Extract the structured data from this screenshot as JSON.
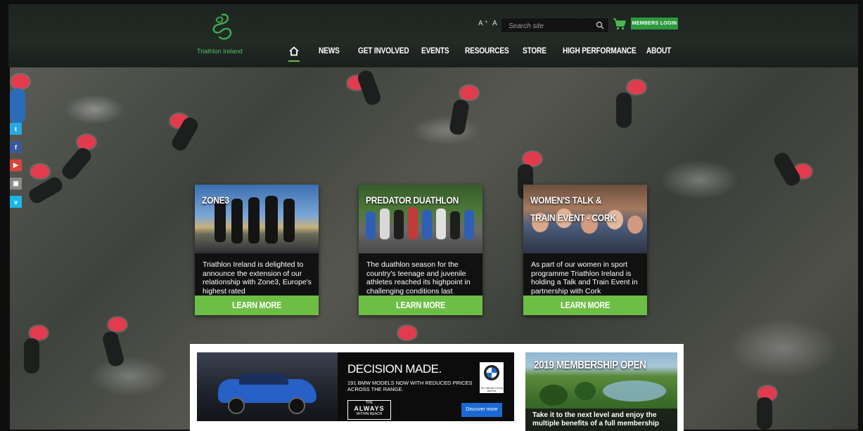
{
  "header": {
    "logo_text": "Triathlon Ireland",
    "font_size_controls": "A⁺ A",
    "search_placeholder": "Search site",
    "members_login": "MEMBERS LOGIN"
  },
  "nav": {
    "items": [
      "NEWS",
      "GET INVOLVED",
      "EVENTS",
      "RESOURCES",
      "STORE",
      "HIGH PERFORMANCE",
      "ABOUT"
    ]
  },
  "social": [
    {
      "icon": "twitter-icon",
      "glyph": "t",
      "color": "#29a9e1"
    },
    {
      "icon": "facebook-icon",
      "glyph": "f",
      "color": "#3b5998"
    },
    {
      "icon": "youtube-icon",
      "glyph": "▶",
      "color": "#d9443b"
    },
    {
      "icon": "instagram-icon",
      "glyph": "▣",
      "color": "#8a8a8a"
    },
    {
      "icon": "vimeo-icon",
      "glyph": "v",
      "color": "#1ab7ea"
    }
  ],
  "cards": [
    {
      "title": "ZONE3",
      "text": "Triathlon Ireland is delighted to announce the extension of our relationship with Zone3, Europe's highest rated",
      "button": "LEARN MORE"
    },
    {
      "title": "PREDATOR DUATHLON",
      "text": "The duathlon season for the country's teenage and juvenile athletes reached its highpoint in challenging conditions last",
      "button": "LEARN MORE"
    },
    {
      "title": "WOMEN'S TALK & TRAIN EVENT - CORK",
      "text": "As part of our women in sport programme Triathlon Ireland is holding a Talk and Train Event in partnership with Cork",
      "button": "LEARN MORE"
    }
  ],
  "bmw_ad": {
    "headline": "DECISION MADE.",
    "subtext": "191 BMW MODELS NOW WITH REDUCED PRICES ACROSS THE RANGE.",
    "tag_top": "THE",
    "tag_main": "ALWAYS",
    "tag_bottom": "WITHIN REACH",
    "logo_caption": "The Ultimate Driving Machine",
    "cta": "Discover more"
  },
  "membership": {
    "title": "2019 MEMBERSHIP OPEN",
    "text": "Take it to the next level and enjoy the multiple benefits of a full membership"
  }
}
